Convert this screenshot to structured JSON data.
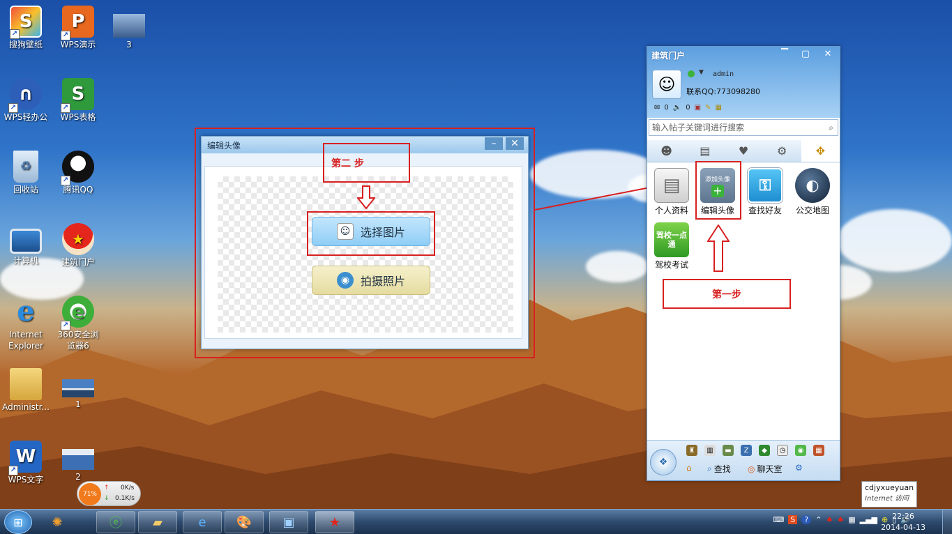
{
  "desktop": {
    "icons": [
      {
        "label": "搜狗壁纸",
        "icon": "sogou-wallpaper-icon"
      },
      {
        "label": "WPS演示",
        "icon": "wps-presentation-icon"
      },
      {
        "label": "3",
        "icon": "image-file-icon"
      },
      {
        "label": "WPS轻办公",
        "icon": "wps-light-office-icon"
      },
      {
        "label": "WPS表格",
        "icon": "wps-spreadsheet-icon"
      },
      {
        "label": "回收站",
        "icon": "recycle-bin-icon"
      },
      {
        "label": "腾讯QQ",
        "icon": "qq-penguin-icon"
      },
      {
        "label": "计算机",
        "icon": "computer-icon"
      },
      {
        "label": "建筑门户",
        "icon": "mushroom-icon"
      },
      {
        "label": "Internet Explorer",
        "icon": "ie-icon"
      },
      {
        "label": "360安全浏览器6",
        "icon": "360-browser-icon"
      },
      {
        "label": "Administr...",
        "icon": "user-folder-icon"
      },
      {
        "label": "1",
        "icon": "image-file-icon"
      },
      {
        "label": "WPS文字",
        "icon": "wps-writer-icon"
      },
      {
        "label": "2",
        "icon": "image-file-icon"
      }
    ],
    "net_widget": {
      "percent": "71%",
      "up": "0K/s",
      "down": "0.1K/s"
    }
  },
  "dialog": {
    "title": "编辑头像",
    "step_label": "第二 步",
    "select_button": "选择图片",
    "camera_button": "拍摄照片"
  },
  "panel": {
    "title": "建筑门户",
    "username": "admin",
    "contact": "联系QQ:773098280",
    "mail_count": "0",
    "sound_count": "0",
    "search_placeholder": "输入帖子关键词进行搜索",
    "apps": [
      {
        "label": "个人资料",
        "icon": "profile-card-icon"
      },
      {
        "label": "编辑头像",
        "icon": "add-avatar-icon",
        "tile_text": "添加头像"
      },
      {
        "label": "查找好友",
        "icon": "key-icon"
      },
      {
        "label": "公交地图",
        "icon": "globe-icon"
      },
      {
        "label": "驾校考试",
        "icon": "driving-school-icon",
        "tile_text": "驾校一点通"
      }
    ],
    "step_label": "第一步",
    "footer": {
      "find_label": "查找",
      "chat_label": "聊天室"
    }
  },
  "tooltip": {
    "line1": "cdjyxueyuan",
    "line2": "Internet 访问"
  },
  "taskbar": {
    "time": "22:26",
    "date": "2014-04-13"
  },
  "colors": {
    "annotation_red": "#d82020",
    "select_button": "#9fd4f7",
    "camera_button": "#efe6b4"
  }
}
